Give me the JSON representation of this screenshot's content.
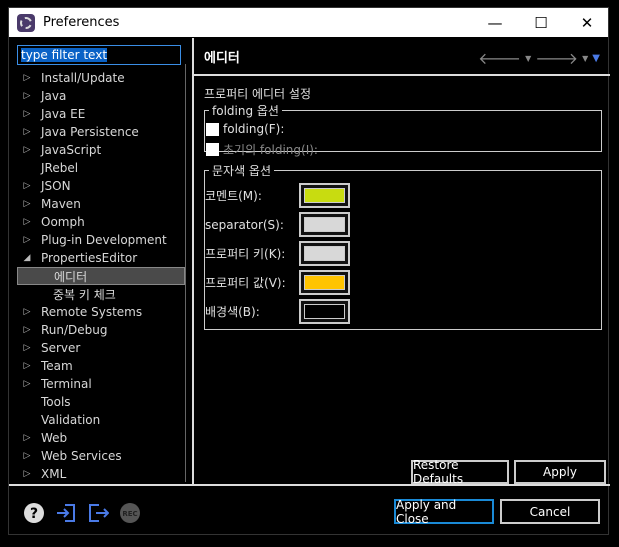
{
  "window": {
    "title": "Preferences",
    "minimize": "—",
    "maximize": "☐",
    "close": "✕"
  },
  "filter": {
    "value": "type filter text"
  },
  "tree": [
    {
      "label": "Install/Update",
      "expander": "collapsed",
      "level": 0
    },
    {
      "label": "Java",
      "expander": "collapsed",
      "level": 0
    },
    {
      "label": "Java EE",
      "expander": "collapsed",
      "level": 0
    },
    {
      "label": "Java Persistence",
      "expander": "collapsed",
      "level": 0
    },
    {
      "label": "JavaScript",
      "expander": "collapsed",
      "level": 0
    },
    {
      "label": "JRebel",
      "expander": "none",
      "level": 0
    },
    {
      "label": "JSON",
      "expander": "collapsed",
      "level": 0
    },
    {
      "label": "Maven",
      "expander": "collapsed",
      "level": 0
    },
    {
      "label": "Oomph",
      "expander": "collapsed",
      "level": 0
    },
    {
      "label": "Plug-in Development",
      "expander": "collapsed",
      "level": 0
    },
    {
      "label": "PropertiesEditor",
      "expander": "expanded",
      "level": 0
    },
    {
      "label": "에디터",
      "expander": "none",
      "level": 1,
      "selected": true
    },
    {
      "label": "중복 키 체크",
      "expander": "none",
      "level": 1
    },
    {
      "label": "Remote Systems",
      "expander": "collapsed",
      "level": 0
    },
    {
      "label": "Run/Debug",
      "expander": "collapsed",
      "level": 0
    },
    {
      "label": "Server",
      "expander": "collapsed",
      "level": 0
    },
    {
      "label": "Team",
      "expander": "collapsed",
      "level": 0
    },
    {
      "label": "Terminal",
      "expander": "collapsed",
      "level": 0
    },
    {
      "label": "Tools",
      "expander": "none",
      "level": 0
    },
    {
      "label": "Validation",
      "expander": "none",
      "level": 0
    },
    {
      "label": "Web",
      "expander": "collapsed",
      "level": 0
    },
    {
      "label": "Web Services",
      "expander": "collapsed",
      "level": 0
    },
    {
      "label": "XML",
      "expander": "collapsed",
      "level": 0
    }
  ],
  "page": {
    "title": "에디터",
    "description": "프로퍼티 에디터 설정",
    "folding": {
      "legend": "folding 옵션",
      "options": [
        {
          "label": "folding(F):",
          "checked": false,
          "enabled": true
        },
        {
          "label": "초기의 folding(I):",
          "checked": false,
          "enabled": false
        }
      ]
    },
    "colors": {
      "legend": "문자색 옵션",
      "items": [
        {
          "label": "코멘트(M):",
          "color": "#c8dc10"
        },
        {
          "label": "separator(S):",
          "color": "#d8d8d8"
        },
        {
          "label": "프로퍼티 키(K):",
          "color": "#d8d8d8"
        },
        {
          "label": "프로퍼티 값(V):",
          "color": "#ffc400"
        },
        {
          "label": "배경색(B):",
          "color": "#000000"
        }
      ]
    },
    "restore_defaults": "Restore Defaults",
    "apply": "Apply"
  },
  "footer": {
    "apply_close": "Apply and Close",
    "cancel": "Cancel",
    "rec": "REC"
  }
}
